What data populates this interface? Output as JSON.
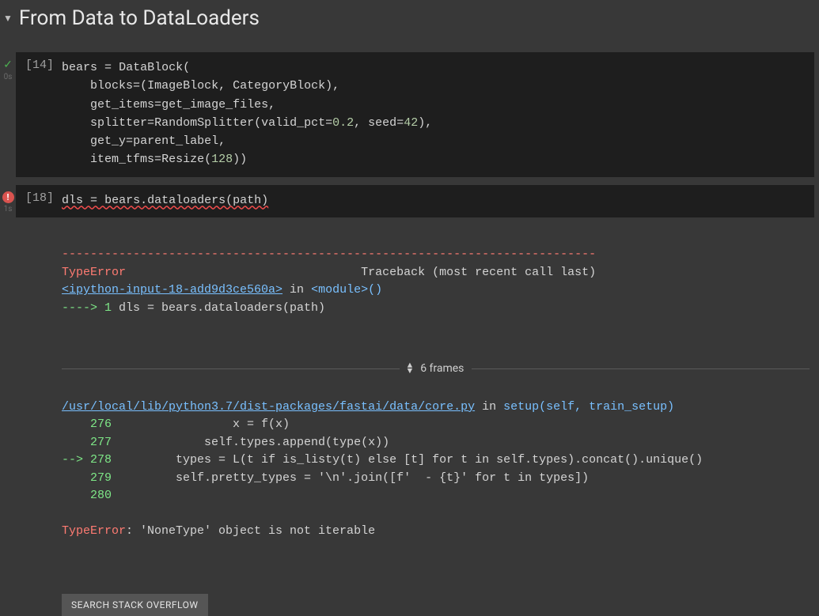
{
  "section": {
    "title": "From Data to DataLoaders"
  },
  "cells": [
    {
      "status": "success",
      "status_glyph": "✓",
      "time": "0s",
      "exec_count": "[14]",
      "code_plain": "bears = DataBlock(\n    blocks=(ImageBlock, CategoryBlock),\n    get_items=get_image_files,\n    splitter=RandomSplitter(valid_pct=0.2, seed=42),\n    get_y=parent_label,\n    item_tfms=Resize(128))"
    },
    {
      "status": "error",
      "status_glyph": "!",
      "time": "1s",
      "exec_count": "[18]",
      "code_plain": "dls = bears.dataloaders(path)"
    }
  ],
  "traceback": {
    "separator": "---------------------------------------------------------------------------",
    "error_type": "TypeError",
    "header_right": "Traceback (most recent call last)",
    "ipython_link": "<ipython-input-18-add9d3ce560a>",
    "in_module": " in ",
    "module_call": "<module>",
    "module_paren": "()",
    "arrow1": "----> 1",
    "arrow1_code": " dls = bears.dataloaders(path)",
    "frames_label": "6 frames",
    "source_link": "/usr/local/lib/python3.7/dist-packages/fastai/data/core.py",
    "source_in": " in ",
    "source_fn": "setup",
    "source_args": "(self, train_setup)",
    "lines": {
      "l276_num": "    276",
      "l276_code": "                 x = f(x)",
      "l277_num": "    277",
      "l277_code": "             self.types.append(type(x))",
      "l278_arrow": "--> ",
      "l278_num": "278",
      "l278_code": "         types = L(t if is_listy(t) else [t] for t in self.types).concat().unique()",
      "l279_num": "    279",
      "l279_code": "         self.pretty_types = '\\n'.join([f'  - {t}' for t in types])",
      "l280_num": "    280"
    },
    "final_error_type": "TypeError",
    "final_error_msg": ": 'NoneType' object is not iterable",
    "search_button": "SEARCH STACK OVERFLOW"
  }
}
